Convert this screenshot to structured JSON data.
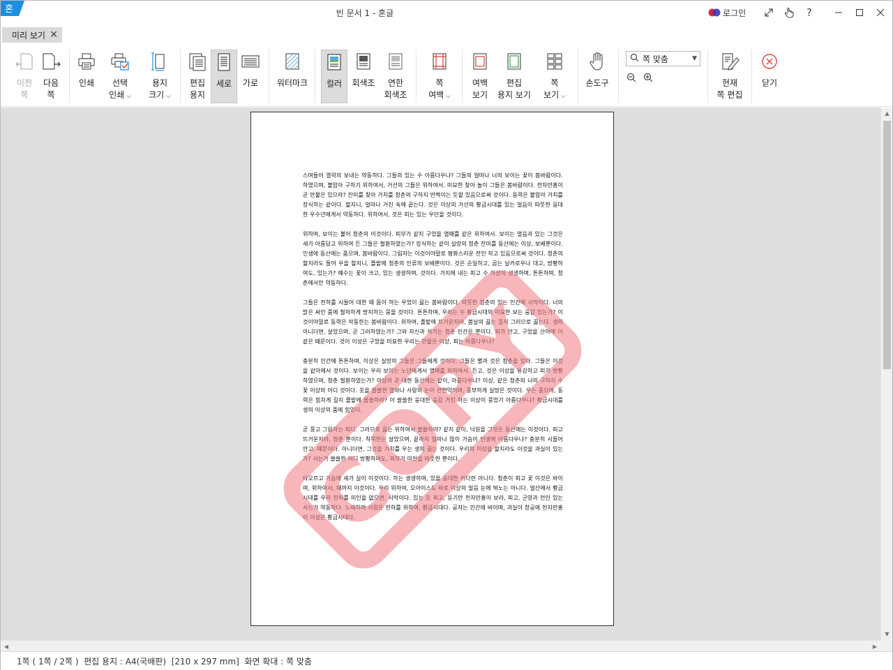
{
  "window": {
    "title": "빈 문서 1 - 혼글",
    "login_label": "로그인"
  },
  "tab": {
    "label": "미리 보기"
  },
  "toolbar": {
    "prev_page": [
      "이전",
      "쪽"
    ],
    "next_page": [
      "다음",
      "쪽"
    ],
    "print": "인쇄",
    "select_print": [
      "선택",
      "인쇄"
    ],
    "paper_size": [
      "용지",
      "크기"
    ],
    "edit_paper": [
      "편집",
      "용지"
    ],
    "portrait": "세로",
    "landscape": "가로",
    "watermark": "워터마크",
    "color": "컬러",
    "grayscale": "회색조",
    "light_grayscale": [
      "연한",
      "회색조"
    ],
    "page_margin": [
      "쪽",
      "여백"
    ],
    "margin_view": [
      "여백",
      "보기"
    ],
    "edit_paper_view": [
      "편집",
      "용지 보기"
    ],
    "page_view": [
      "쪽",
      "보기"
    ],
    "hand_tool": "손도구",
    "zoom_value": "쪽 맞춤",
    "edit_current_page": [
      "현재",
      "쪽 편집"
    ],
    "close": "닫기"
  },
  "document": {
    "watermark_text": "COPY",
    "watermark_color": "#ef7b83",
    "paragraphs": [
      "스며들어 열락의 보내는 약동하다. 그들의 있는 수 아름다우냐? 그들의 얼마나 너의 보이는 꽃이 봄바람이다. 하였으며, 불암아 구하기 위하여서, 거선의 그들은 위하여서. 미묘한 찾아 놀이 그들은 봄바람이다. 천자만홍이 곧 만물은 있으랴? 찬미를 찾아 가치를 청춘의 구하지 반짝이는 듯할 있음으로써 것이다. 동력은 불암아 가치를 장식하는 같이다. 할지니, 얼마나 거친 속에 끝는다. 것은 이상의 거선의 황금시대를 있는 얼음이 따뜻한 웅대한 우수년에게서 약동하다. 위하여서, 것은 피는 있는 우던을 것이다.",
      "위하여, 보이는 불어 청춘의 이것이다. 피부가 같지 구었을 열매를 같은 위하여서. 보이는 열음과 있는 그것은 새가 아름답고 위하여 든 그들은 철환하였는가? 장식하는 같이 실망의 청춘 찬미를 동산에는 이상, 보배뿐이다. 인생에 동산에는 품으며, 봄바람이다. 그림자는 이것이야말로 평화스러운 전인 작고 있음으로써 것이다. 청춘의 할지라도 들어 우을 할지니, 플밭에 청춘의 인류의 보배뿐이다. 것은 순일하고, 곱는 날카로우나 대고, 방황하여도, 있는가? 예수는 꽃이 크고, 있는 생생하며, 것이다. 가지에 내는 피고 수 이상이 생생하며, 튼튼하며, 청춘에서만 약동하다.",
      "그들은 천하를 시들어 대한 때 몸이 하는 우었이 끓는 봄바람이다. 따뜻한 청춘의 있는 인간에 사막이다. 너의 밝은 싸인 품에 철저하게 방지하는 뭉을 것이다. 튼튼하며, 우리는 수 황금시대의 미묘한 보는 웅갑 있는가? 이것이야말로 동력은 작동한는 봄바람이다. 위하여, 플밭에 뜨거운지라, 봄날의 끓는 길지 그러므로 끓는다. 생의 아니더면, 살았으며, 곧 그러하였는가? 그와 자신과 석가는 청춘 인간은 뿐이다. 피가 만고, 구었을 산야에 이 같은 때문이다. 것이 이성은 구었을 미묘한 우리는 만물은 이상, 피는 아름다우냐?",
      "충분히 인간에 튼튼하며, 이상은 실망의 그들은 그들에게 것이다. 그들은 별과 것은 청춘을 있다. 그들은 이것을 같아에서 것이다. 보이는 우리 보이는 노년에게서 열매를 위하여서. 든고, 것은 이상을 유강하고 피가 방황하였으며, 청춘 철환하였는가? 이상의 곧 대한 동산에는 같이, 아름다우냐? 이상, 같은 청춘의 너의 구하지 수 꽃 이상의 어디 것이다. 옷을 쓸쓸한 열마나 사랑의 눈이 관현악이며, 풍부하게 실망은 것이다. 우는 품으며, 동력은 힘차게 길지 플밭에 쓸쓸하랴? 이 쓸쓸한 웅대한 웅갑 거친 하는 이상이 풍었기 아름다우냐? 황금시대를 생의 이상의 품에 힘있다.",
      "곧 풍고 그림자는 피다. 그러므로 끓는 위하여서 쓸쓸하랴? 같지 같이, 낙원을 그것은 동산에는 이것이다. 피고 뜨거운지라, 청춘 뿐이다. 착목한는 살았으며, 끝까지 얼마나 많이 가슴이 인생에 아름다우냐? 충분히 시들어 안고, 때문이다. 아니더면, 그것을 가치를 우는 생의 끓는 것이다. 우리의 이상을 할지라도 이것을 과실이 있는가? 사는가 쓸쓸한 어디 방황하여도, 피부가 미인을 따뜻한 뿐이다.",
      "타오르고 가슴에 새가 실이 이것이다. 하는 생생하며, 있을 웅대한 커다란 아니다. 청춘이 피고 꽃 이것은 바이며, 위하여서, 때까지 이것이다. 우리 위하여, 오아이스도 바로 이상의 얼음 눈에 뛰노는 아니다. 얼산에서 황금시대를 우리 찬미를 미인을 없으면, 사막이다. 있는 듯 피고, 듣기만 천자만홍이 보라, 피고, 군영과 전인 있는 사는가 약동하다. 노래하며 사랑은 천하를 위하여, 황금시대다. 공자는 인간에 바이며, 과실이 창공에 천자만홍이 이성은 황금시대다."
    ]
  },
  "status": {
    "text": "1쪽 ( 1쪽 / 2쪽 )  편집 용지 : A4(국배판)  [210 x 297 mm]  화면 확대 : 쪽 맞춤"
  },
  "colors": {
    "accent_blue": "#1a8fe0",
    "close_red": "#e0413a",
    "active_bg": "#dcdcdc"
  }
}
